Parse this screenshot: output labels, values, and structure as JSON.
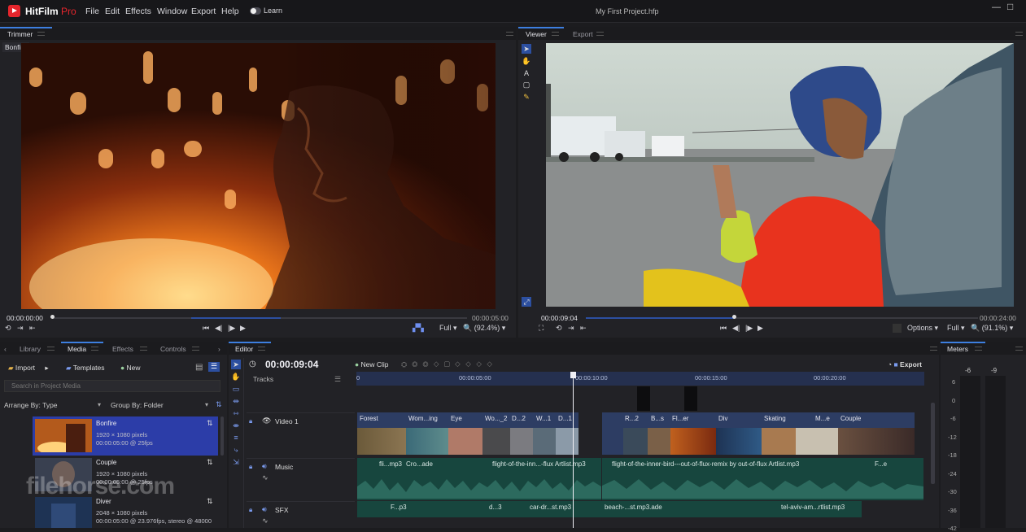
{
  "app": {
    "brand_name": "HitFilm",
    "brand_edition": "Pro",
    "menus": [
      "File",
      "Edit",
      "Effects",
      "Window",
      "Export",
      "Help"
    ],
    "learn_label": "Learn",
    "window_title": "My First Project.hfp",
    "accent": "#3d7fe0",
    "brand_color": "#e5252c"
  },
  "trimmer": {
    "tab_label": "Trimmer",
    "clip_name": "Bonfire",
    "time_current": "00:00:00:00",
    "time_end": "00:00:05:00",
    "quality": "Full",
    "zoom": "(92.4%)"
  },
  "viewer": {
    "tabs": [
      "Viewer",
      "Export"
    ],
    "time_current": "00:00:09:04",
    "time_end": "00:00:24:00",
    "options_label": "Options",
    "quality": "Full",
    "zoom": "(91.1%)"
  },
  "media_panel": {
    "tabs": [
      "Library",
      "Media",
      "Effects",
      "Controls"
    ],
    "import_label": "Import",
    "templates_label": "Templates",
    "new_label": "New",
    "search_placeholder": "Search in Project Media",
    "arrange_label": "Arrange By: Type",
    "group_label": "Group By: Folder",
    "items": [
      {
        "name": "Bonfire",
        "line1": "1920 × 1080 pixels",
        "line2": "00:00:05:00 @ 25fps"
      },
      {
        "name": "Couple",
        "line1": "1920 × 1080 pixels",
        "line2": "00:00:05:00 @ 25fps"
      },
      {
        "name": "Diver",
        "line1": "2048 × 1080 pixels",
        "line2": "00:00:05:00 @ 23.976fps, stereo @ 48000"
      }
    ]
  },
  "editor": {
    "tab_label": "Editor",
    "timecode": "00:00:09:04",
    "new_clip_label": "New Clip",
    "export_label": "Export",
    "tracks_label": "Tracks",
    "ruler": [
      "0",
      "00:00:05:00",
      "00:00:10:00",
      "00:00:15:00",
      "00:00:20:00"
    ],
    "playhead_fraction": 0.382,
    "tracks": [
      {
        "name": "Video 1"
      },
      {
        "name": "Music"
      },
      {
        "name": "SFX"
      }
    ],
    "video_clip_labels": [
      "Forest",
      "Wom...ing",
      "Eye",
      "Wo..._2",
      "D...2",
      "W...1",
      "D...1",
      "R...2",
      "B...s",
      "Fl...er",
      "Div",
      "Skating",
      "M...e",
      "Couple"
    ],
    "music_clip_labels": [
      "fli...mp3",
      "Cro...ade",
      "flight-of-the-inn...-flux Artlist.mp3",
      "flight-of-the-inner-bird---out-of-flux-remix by out-of-flux Artlist.mp3",
      "F...e"
    ],
    "sfx_clip_labels": [
      "F...p3",
      "d...3",
      "car-dr...st.mp3",
      "beach-...st.mp3.ade",
      "tel-aviv-am...rtlist.mp3"
    ]
  },
  "meters": {
    "tab_label": "Meters",
    "channels": [
      "-6",
      "-9"
    ],
    "db_scale": [
      "6",
      "0",
      "-6",
      "-12",
      "-18",
      "-24",
      "-30",
      "-36",
      "-42"
    ]
  },
  "watermark": "filehorse.com"
}
